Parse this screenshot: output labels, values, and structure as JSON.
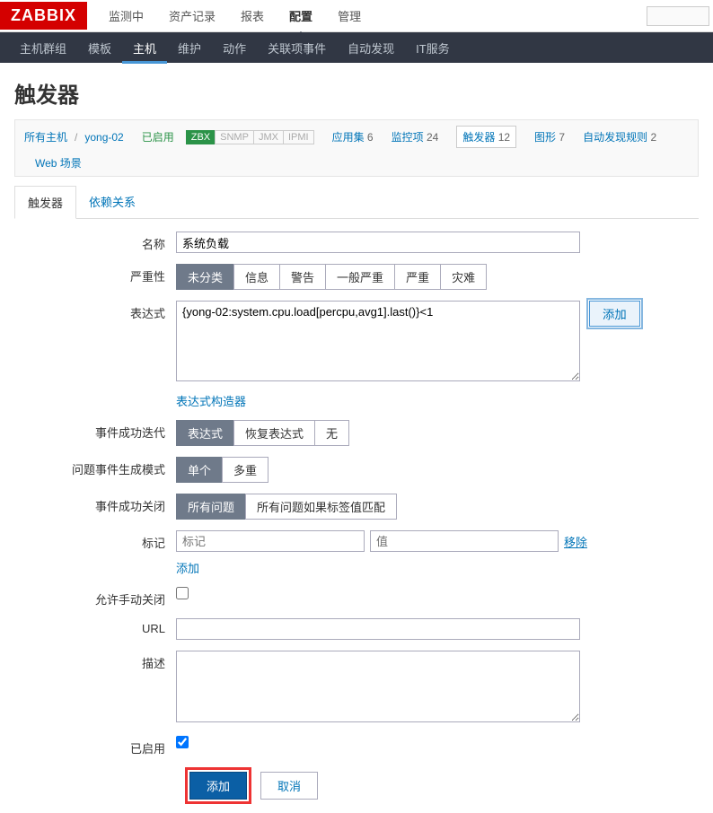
{
  "logo": "ZABBIX",
  "topnav": [
    "监测中",
    "资产记录",
    "报表",
    "配置",
    "管理"
  ],
  "topnav_active": 3,
  "subnav": [
    "主机群组",
    "模板",
    "主机",
    "维护",
    "动作",
    "关联项事件",
    "自动发现",
    "IT服务"
  ],
  "subnav_active": 2,
  "page_title": "触发器",
  "hostbar": {
    "all_hosts": "所有主机",
    "host": "yong-02",
    "status": "已启用",
    "badges": [
      "ZBX",
      "SNMP",
      "JMX",
      "IPMI"
    ],
    "links": [
      {
        "label": "应用集",
        "count": "6"
      },
      {
        "label": "监控项",
        "count": "24"
      },
      {
        "label": "触发器",
        "count": "12",
        "active": true
      },
      {
        "label": "图形",
        "count": "7"
      },
      {
        "label": "自动发现规则",
        "count": "2"
      },
      {
        "label": "Web 场景",
        "count": ""
      }
    ]
  },
  "tabs": [
    "触发器",
    "依赖关系"
  ],
  "tabs_active": 0,
  "form": {
    "name_label": "名称",
    "name_value": "系统负载",
    "severity_label": "严重性",
    "severity_options": [
      "未分类",
      "信息",
      "警告",
      "一般严重",
      "严重",
      "灾难"
    ],
    "expr_label": "表达式",
    "expr_value": "{yong-02:system.cpu.load[percpu,avg1].last()}<1",
    "expr_add": "添加",
    "expr_builder": "表达式构造器",
    "event_iter_label": "事件成功迭代",
    "event_iter_options": [
      "表达式",
      "恢复表达式",
      "无"
    ],
    "problem_gen_label": "问题事件生成模式",
    "problem_gen_options": [
      "单个",
      "多重"
    ],
    "event_close_label": "事件成功关闭",
    "event_close_options": [
      "所有问题",
      "所有问题如果标签值匹配"
    ],
    "tags_label": "标记",
    "tag_name_ph": "标记",
    "tag_value_ph": "值",
    "tag_remove": "移除",
    "tag_add": "添加",
    "manual_close_label": "允许手动关闭",
    "url_label": "URL",
    "desc_label": "描述",
    "enabled_label": "已启用",
    "enabled_checked": true,
    "submit": "添加",
    "cancel": "取消"
  }
}
